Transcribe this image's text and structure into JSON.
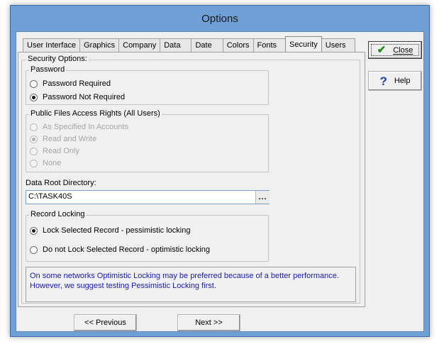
{
  "window": {
    "title": "Options"
  },
  "tabs": [
    {
      "label": "User Interface"
    },
    {
      "label": "Graphics"
    },
    {
      "label": "Company"
    },
    {
      "label": "Data"
    },
    {
      "label": "Date"
    },
    {
      "label": "Colors"
    },
    {
      "label": "Fonts"
    },
    {
      "label": "Security",
      "active": true
    },
    {
      "label": "Users"
    }
  ],
  "security": {
    "group_label": "Security Options:",
    "password": {
      "label": "Password",
      "options": [
        "Password Required",
        "Password Not Required"
      ],
      "selected": "Password Not Required"
    },
    "public_files": {
      "label": "Public Files Access Rights (All Users)",
      "options": [
        "As Specified In Accounts",
        "Read and Write",
        "Read Only",
        "None"
      ],
      "selected": "Read and Write",
      "disabled": true
    },
    "data_root": {
      "label": "Data Root Directory:",
      "value": "C:\\TASK40S",
      "browse_label": "..."
    },
    "record_locking": {
      "label": "Record Locking",
      "options": [
        "Lock Selected Record - pessimistic locking",
        "Do not Lock Selected Record - optimistic locking"
      ],
      "selected": "Lock Selected Record - pessimistic locking"
    },
    "note_line1": "On some networks Optimistic Locking may be preferred because of a better performance.",
    "note_line2": "However, we suggest testing Pessimistic Locking first."
  },
  "buttons": {
    "close": "Close",
    "help": "Help",
    "previous": "<< Previous",
    "next": "Next >>"
  },
  "icons": {
    "close": "checkmark-icon",
    "help": "question-icon"
  },
  "colors": {
    "frame": "#6f9fd4",
    "checkmark": "#1e8a1e",
    "help": "#1b3fa8",
    "note_text": "#1a1ab0"
  }
}
